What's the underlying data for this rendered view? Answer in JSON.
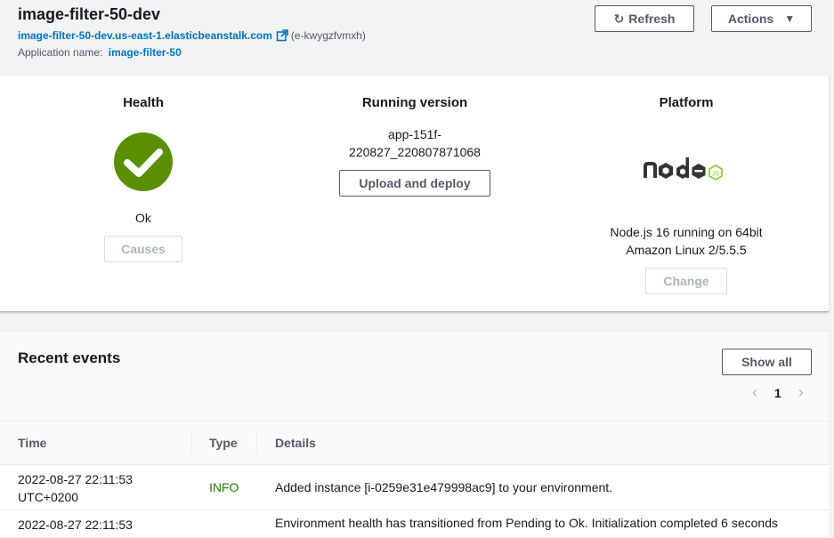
{
  "header": {
    "env_name": "image-filter-50-dev",
    "env_url": "image-filter-50-dev.us-east-1.elasticbeanstalk.com",
    "env_id": "(e-kwygzfvmxh)",
    "app_label": "Application name:",
    "app_name": "image-filter-50",
    "refresh_label": "Refresh",
    "actions_label": "Actions"
  },
  "health": {
    "title": "Health",
    "status": "Ok",
    "status_color": "#5a8f00",
    "causes_label": "Causes"
  },
  "version": {
    "title": "Running version",
    "line1": "app-151f-",
    "line2": "220827_220807871068",
    "upload_label": "Upload and deploy"
  },
  "platform": {
    "title": "Platform",
    "logo": "node-js-logo",
    "line1": "Node.js 16 running on 64bit",
    "line2": "Amazon Linux 2/5.5.5",
    "change_label": "Change"
  },
  "events": {
    "title": "Recent events",
    "show_all_label": "Show all",
    "page": "1",
    "columns": [
      "Time",
      "Type",
      "Details"
    ],
    "rows": [
      {
        "time_line1": "2022-08-27 22:11:53",
        "time_line2": "UTC+0200",
        "type": "INFO",
        "details": "Added instance [i-0259e31e479998ac9] to your environment."
      },
      {
        "time_line1": "2022-08-27 22:11:53",
        "time_line2": "",
        "type": "",
        "details": "Environment health has transitioned from Pending to Ok. Initialization completed 6 seconds"
      }
    ]
  }
}
